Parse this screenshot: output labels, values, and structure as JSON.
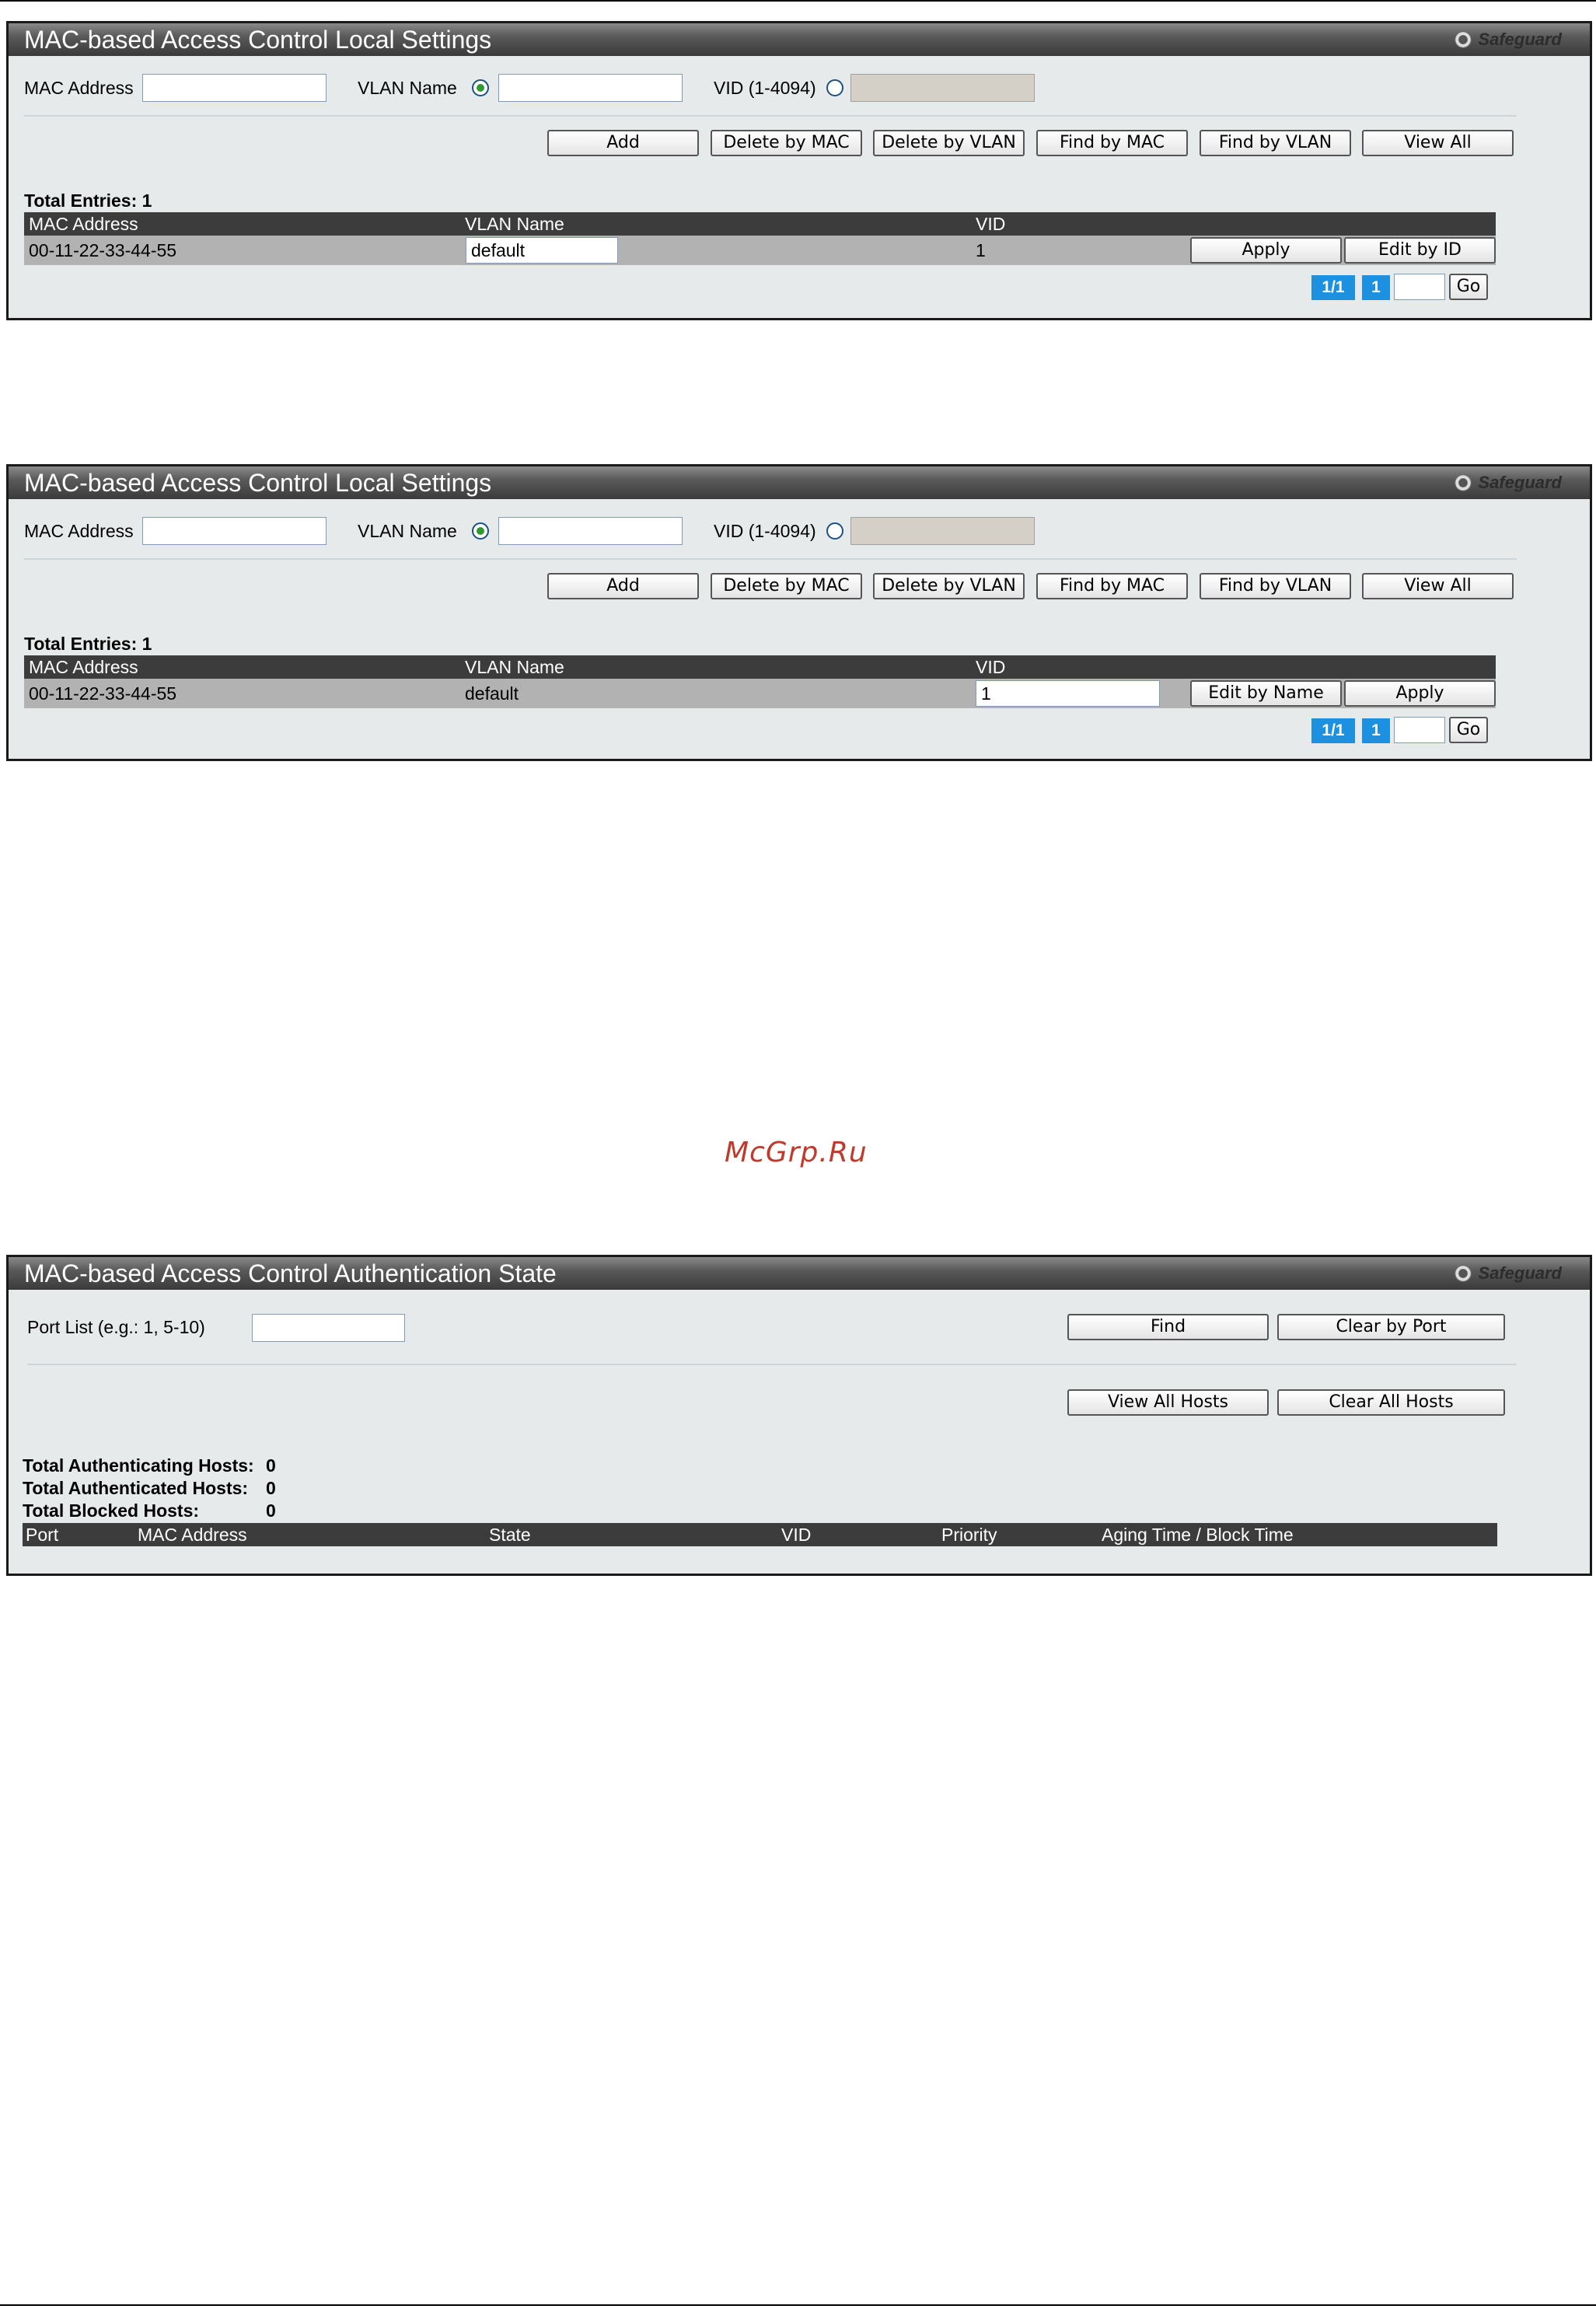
{
  "panel1": {
    "title": "MAC-based Access Control Local Settings",
    "safeguard": "Safeguard",
    "mac_label": "MAC Address",
    "vlan_name_label": "VLAN Name",
    "vid_label": "VID (1-4094)",
    "buttons": [
      "Add",
      "Delete by MAC",
      "Delete by VLAN",
      "Find by MAC",
      "Find by VLAN",
      "View All"
    ],
    "total_entries": "Total Entries: 1",
    "columns": [
      "MAC Address",
      "VLAN Name",
      "VID"
    ],
    "row": {
      "mac": "00-11-22-33-44-55",
      "vlan_name": "default",
      "vid": "1"
    },
    "row_buttons": [
      "Apply",
      "Edit by ID"
    ],
    "page_info": "1/1",
    "page_num": "1",
    "go": "Go"
  },
  "panel2": {
    "title": "MAC-based Access Control Local Settings",
    "safeguard": "Safeguard",
    "mac_label": "MAC Address",
    "vlan_name_label": "VLAN Name",
    "vid_label": "VID (1-4094)",
    "buttons": [
      "Add",
      "Delete by MAC",
      "Delete by VLAN",
      "Find by MAC",
      "Find by VLAN",
      "View All"
    ],
    "total_entries": "Total Entries: 1",
    "columns": [
      "MAC Address",
      "VLAN Name",
      "VID"
    ],
    "row": {
      "mac": "00-11-22-33-44-55",
      "vlan_name": "default",
      "vid": "1"
    },
    "row_buttons": [
      "Edit by Name",
      "Apply"
    ],
    "page_info": "1/1",
    "page_num": "1",
    "go": "Go"
  },
  "watermark": "McGrp.Ru",
  "panel3": {
    "title": "MAC-based Access Control Authentication State",
    "safeguard": "Safeguard",
    "port_list_label": "Port List (e.g.: 1, 5-10)",
    "buttons": [
      "Find",
      "Clear by Port",
      "View All Hosts",
      "Clear All Hosts"
    ],
    "stats": [
      {
        "label": "Total Authenticating Hosts:",
        "value": "0"
      },
      {
        "label": "Total Authenticated Hosts:",
        "value": "0"
      },
      {
        "label": "Total Blocked Hosts:",
        "value": "0"
      }
    ],
    "columns": [
      "Port",
      "MAC Address",
      "State",
      "VID",
      "Priority",
      "Aging Time / Block Time"
    ]
  }
}
